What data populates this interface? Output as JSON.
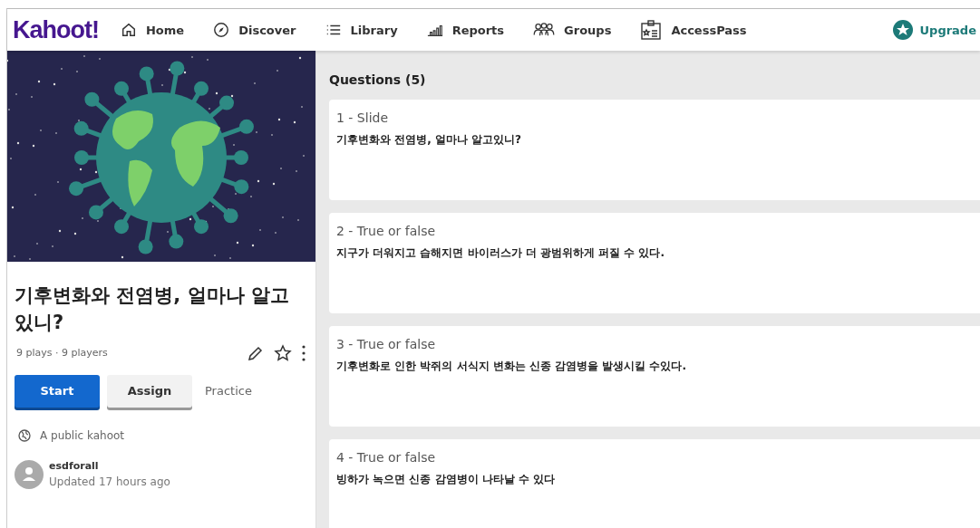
{
  "nav": {
    "logo": "Kahoot!",
    "items": [
      {
        "kind": "home",
        "label": "Home"
      },
      {
        "kind": "discover",
        "label": "Discover"
      },
      {
        "kind": "library",
        "label": "Library"
      },
      {
        "kind": "reports",
        "label": "Reports"
      },
      {
        "kind": "groups",
        "label": "Groups"
      },
      {
        "kind": "accesspass",
        "label": "AccessPass"
      }
    ],
    "upgrade": "Upgrade"
  },
  "kahoot": {
    "title": "기후변화와 전염병, 얼마나 알고있니?",
    "stats": "9 plays · 9 players",
    "favorite": false,
    "buttons": [
      {
        "kind": "primary",
        "label": "Start"
      },
      {
        "kind": "secondary",
        "label": "Assign"
      },
      {
        "kind": "link",
        "label": "Practice"
      }
    ],
    "visibility": "A public kahoot",
    "author": "esdforall",
    "updated": "Updated 17 hours ago"
  },
  "questions": {
    "heading": "Questions (5)",
    "items": [
      {
        "type": "1 - Slide",
        "text": "기후변화와 전염병, 얼마나 알고있니?"
      },
      {
        "type": "2 - True or false",
        "text": "지구가 더워지고 습해지면 바이러스가 더 광범위하게 퍼질 수 있다."
      },
      {
        "type": "3 - True or false",
        "text": "기후변화로 인한 박쥐의 서식지 변화는 신종 감염병을 발생시킬 수있다."
      },
      {
        "type": "4 - True or false",
        "text": "빙하가 녹으면 신종 감염병이 나타날 수 있다"
      }
    ]
  }
}
